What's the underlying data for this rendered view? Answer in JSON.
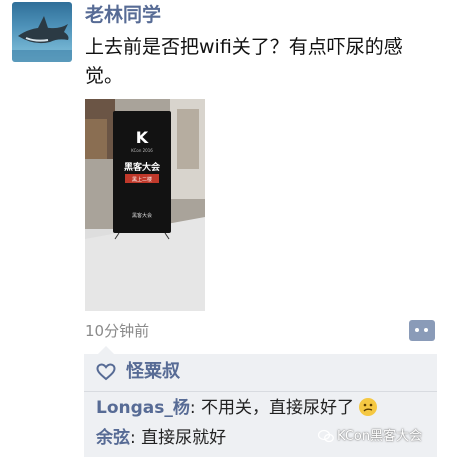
{
  "post": {
    "username": "老林同学",
    "text": "上去前是否把wifi关了？有点吓尿的感觉。",
    "timestamp": "10分钟前",
    "photo": {
      "logo_letter": "K",
      "logo_sub": "KCon 2016",
      "title": "黑客大会",
      "subtitle": "黑上二楼",
      "bottom": "黑客大会"
    }
  },
  "likes": {
    "names": "怪粟叔"
  },
  "comments": [
    {
      "author": "Longas_杨",
      "separator": ": ",
      "text": "不用关，直接尿好了"
    },
    {
      "author": "余弦",
      "separator": ": ",
      "text": "直接尿就好"
    }
  ],
  "watermark": {
    "text": "KCon黑客大会"
  },
  "colors": {
    "link_blue": "#576b95",
    "comment_bg": "#eef0f3",
    "comment_button": "#8a9bb8"
  },
  "icons": [
    "shark-avatar",
    "comment-bubble-icon",
    "heart-icon",
    "confused-emoji-icon",
    "wechat-icon"
  ]
}
